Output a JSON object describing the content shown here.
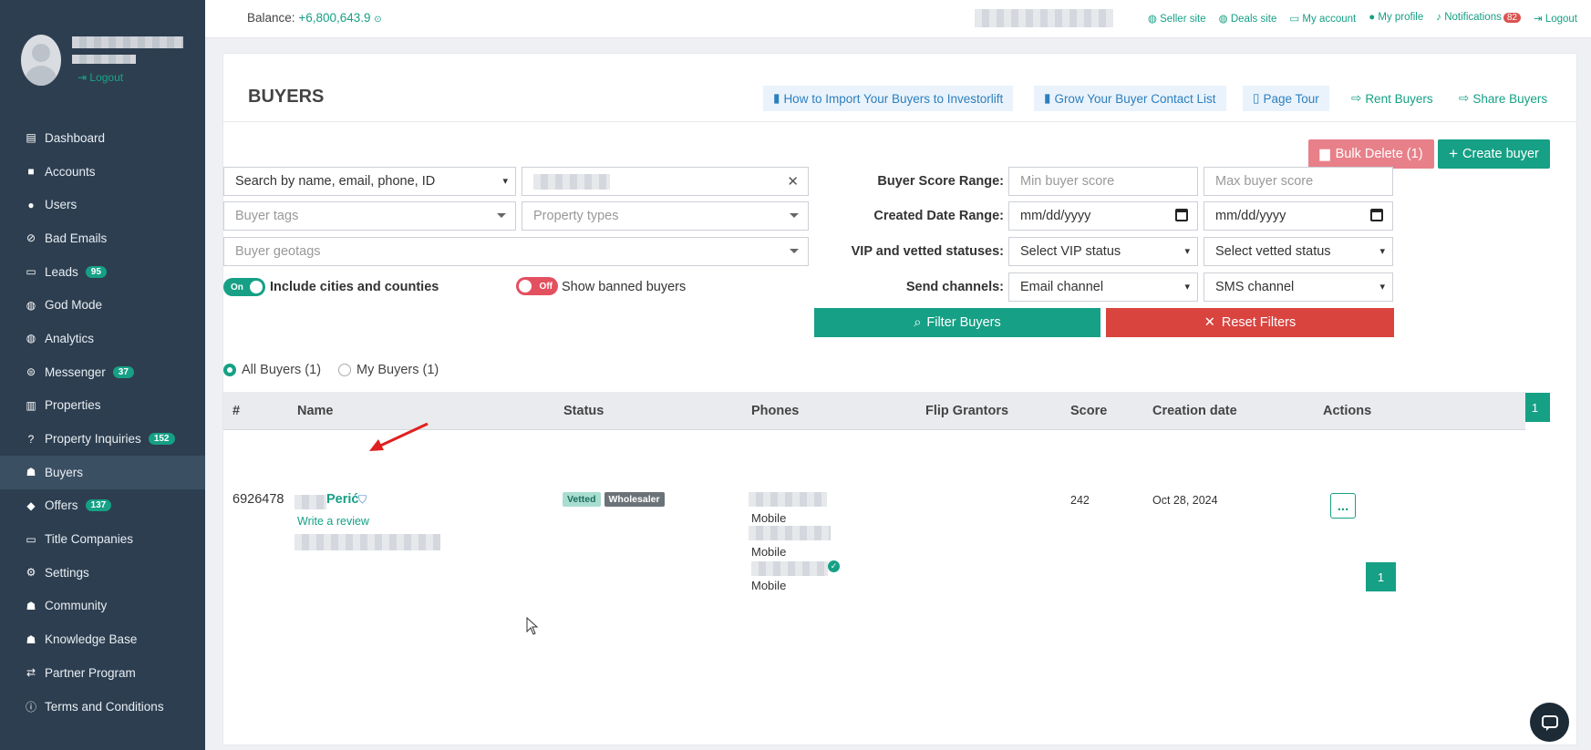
{
  "sidebar": {
    "logout_label": "Logout",
    "items": [
      {
        "label": "Dashboard",
        "icon": "chart-icon"
      },
      {
        "label": "Accounts",
        "icon": "briefcase-icon"
      },
      {
        "label": "Users",
        "icon": "user-icon"
      },
      {
        "label": "Bad Emails",
        "icon": "ban-icon"
      },
      {
        "label": "Leads",
        "icon": "id-card-icon",
        "badge": "95"
      },
      {
        "label": "God Mode",
        "icon": "globe-icon"
      },
      {
        "label": "Analytics",
        "icon": "globe-icon"
      },
      {
        "label": "Messenger",
        "icon": "message-icon",
        "badge": "37"
      },
      {
        "label": "Properties",
        "icon": "building-icon"
      },
      {
        "label": "Property Inquiries",
        "icon": "question-icon",
        "badge": "152"
      },
      {
        "label": "Buyers",
        "icon": "people-icon",
        "active": true
      },
      {
        "label": "Offers",
        "icon": "tag-icon",
        "badge": "137"
      },
      {
        "label": "Title Companies",
        "icon": "card-icon"
      },
      {
        "label": "Settings",
        "icon": "gear-icon"
      },
      {
        "label": "Community",
        "icon": "users-icon"
      },
      {
        "label": "Knowledge Base",
        "icon": "users-icon"
      },
      {
        "label": "Partner Program",
        "icon": "handshake-icon"
      },
      {
        "label": "Terms and Conditions",
        "icon": "info-icon"
      }
    ]
  },
  "topbar": {
    "balance_label": "Balance:",
    "balance_value": "+6,800,643.9",
    "links": {
      "seller_site": "Seller site",
      "deals_site": "Deals site",
      "my_account": "My account",
      "my_profile": "My profile",
      "notifications": "Notifications",
      "notifications_count": "82",
      "logout": "Logout"
    }
  },
  "page": {
    "title": "BUYERS",
    "header_links": {
      "import": "How to Import Your Buyers to Investorlift",
      "grow": "Grow Your Buyer Contact List",
      "tour": "Page Tour",
      "rent": "Rent Buyers",
      "share": "Share Buyers"
    },
    "bulk_delete": "Bulk Delete (1)",
    "create_buyer": "Create buyer"
  },
  "filters": {
    "search_type": "Search by name, email, phone, ID",
    "buyer_tags_placeholder": "Buyer tags",
    "property_types_placeholder": "Property types",
    "buyer_geotags_placeholder": "Buyer geotags",
    "include_cities_toggle": "On",
    "include_cities_label": "Include cities and counties",
    "banned_toggle": "Off",
    "banned_label": "Show banned buyers",
    "score_range_label": "Buyer Score Range:",
    "min_score_placeholder": "Min buyer score",
    "max_score_placeholder": "Max buyer score",
    "created_date_label": "Created Date Range:",
    "date_from": "mm/dd/yyyy",
    "date_to": "mm/dd/yyyy",
    "vip_label": "VIP and vetted statuses:",
    "vip_select": "Select VIP status",
    "vetted_select": "Select vetted status",
    "channels_label": "Send channels:",
    "email_channel": "Email channel",
    "sms_channel": "SMS channel",
    "filter_button": "Filter Buyers",
    "reset_button": "Reset Filters"
  },
  "scope": {
    "all": "All Buyers (1)",
    "mine": "My Buyers (1)",
    "selected": "all"
  },
  "pagination": {
    "current": "1"
  },
  "table": {
    "columns": [
      "#",
      "Name",
      "Status",
      "Phones",
      "Flip Grantors",
      "Score",
      "Creation date",
      "Actions"
    ],
    "rows": [
      {
        "id": "6926478",
        "name": "Perić",
        "review_link": "Write a review",
        "tags": [
          "Vetted",
          "Wholesaler"
        ],
        "phone_types": [
          "Mobile",
          "Mobile",
          "Mobile"
        ],
        "flip_grantors": "",
        "score": "242",
        "created": "Oct 28, 2024",
        "actions_label": "..."
      }
    ]
  },
  "colors": {
    "accent": "#16a085",
    "sidebar": "#2d3e50",
    "danger": "#d9443f"
  }
}
